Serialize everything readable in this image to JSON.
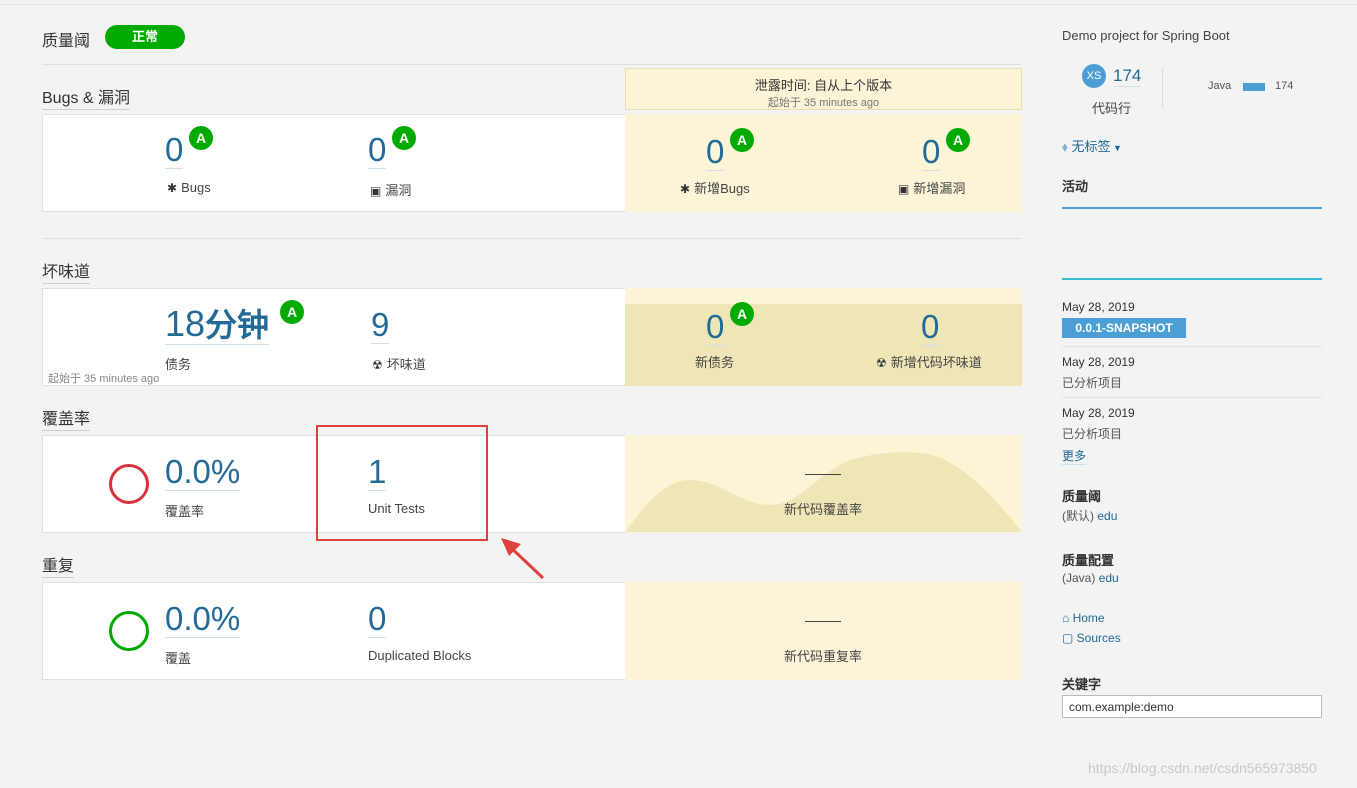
{
  "quality_gate": {
    "title": "质量阈",
    "status": "正常"
  },
  "bugs_section": {
    "title": "Bugs & 漏洞",
    "leak_period": {
      "title": "泄露时间: 自从上个版本",
      "since": "起始于 35 minutes ago"
    },
    "bugs": {
      "value": "0",
      "rating": "A",
      "label": "Bugs"
    },
    "vulnerabilities": {
      "value": "0",
      "rating": "A",
      "label": "漏洞"
    },
    "new_bugs": {
      "value": "0",
      "rating": "A",
      "label": "新增Bugs"
    },
    "new_vulnerabilities": {
      "value": "0",
      "rating": "A",
      "label": "新增漏洞"
    }
  },
  "smells_section": {
    "title": "坏味道",
    "debt": {
      "value_num": "18",
      "value_unit": "分钟",
      "rating": "A",
      "label": "债务"
    },
    "code_smells": {
      "value": "9",
      "label": "坏味道"
    },
    "since": "起始于 35 minutes ago",
    "new_debt": {
      "value": "0",
      "rating": "A",
      "label": "新债务"
    },
    "new_code_smells": {
      "value": "0",
      "label": "新增代码坏味道"
    }
  },
  "coverage_section": {
    "title": "覆盖率",
    "coverage": {
      "value": "0.0%",
      "label": "覆盖率"
    },
    "unit_tests": {
      "value": "1",
      "label": "Unit Tests"
    },
    "new_coverage": {
      "value": "—",
      "label": "新代码覆盖率"
    }
  },
  "duplication_section": {
    "title": "重复",
    "duplication": {
      "value": "0.0%",
      "label": "覆盖"
    },
    "duplicated_blocks": {
      "value": "0",
      "label": "Duplicated Blocks"
    },
    "new_duplication": {
      "value": "—",
      "label": "新代码重复率"
    }
  },
  "sidebar": {
    "project_description": "Demo project for Spring Boot",
    "size_badge": "XS",
    "lines": "174",
    "lines_label": "代码行",
    "language": "Java",
    "language_lines": "174",
    "tags": "无标签",
    "activity_title": "活动",
    "activity": [
      {
        "date": "May 28, 2019",
        "version": "0.0.1-SNAPSHOT"
      },
      {
        "date": "May 28, 2019",
        "text": "已分析项目"
      },
      {
        "date": "May 28, 2019",
        "text": "已分析项目"
      }
    ],
    "more": "更多",
    "quality_gate_label": "质量阈",
    "quality_gate_default": "(默认)",
    "quality_gate_value": "edu",
    "quality_profiles_label": "质量配置",
    "quality_profiles_lang": "(Java)",
    "quality_profiles_value": "edu",
    "links": {
      "home": "Home",
      "sources": "Sources"
    },
    "key_label": "关键字",
    "key_value": "com.example:demo"
  },
  "watermark": "https://blog.csdn.net/csdn565973850",
  "colors": {
    "good": "#00aa00",
    "bad": "#d4333f",
    "accent": "#236a97",
    "leak": "#fbf4d6"
  }
}
